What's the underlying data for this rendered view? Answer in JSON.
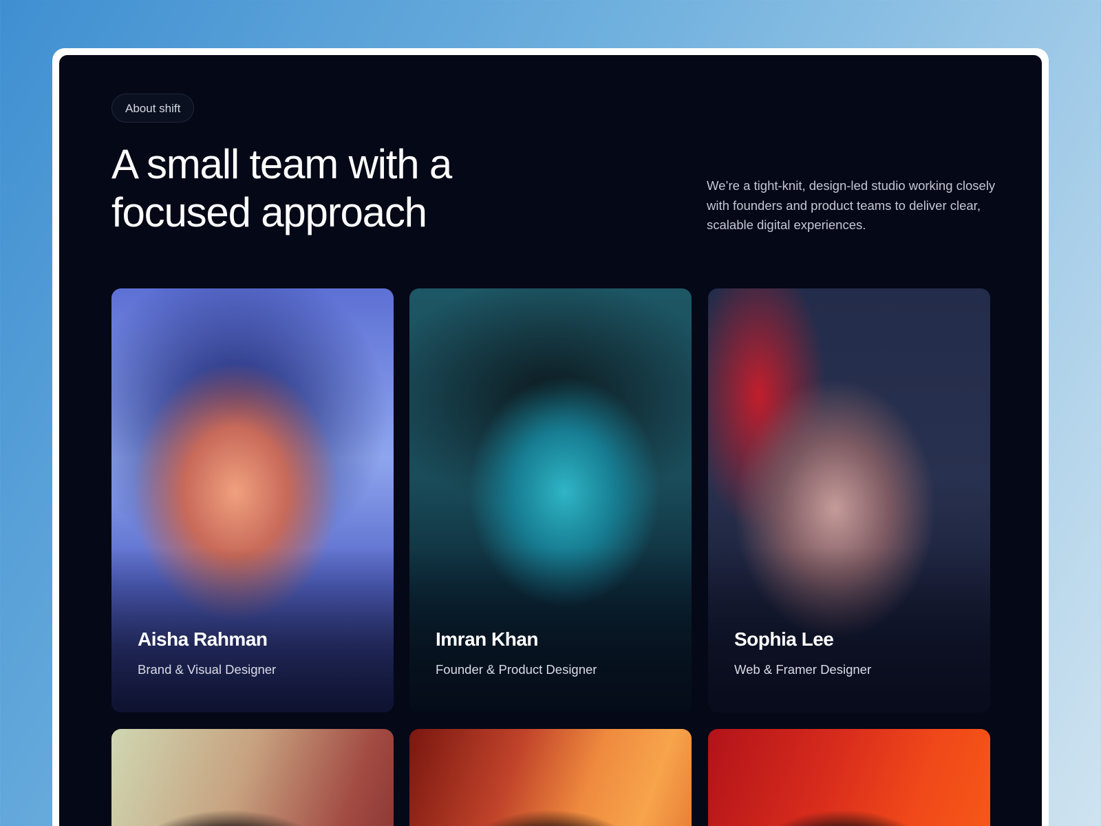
{
  "badge": {
    "label": "About shift"
  },
  "hero": {
    "title": "A small team with a focused approach",
    "description": "We’re a tight-knit, design-led studio working closely with founders and product teams to deliver clear, scalable digital experiences."
  },
  "team": {
    "members": [
      {
        "name": "Aisha Rahman",
        "role": "Brand & Visual Designer"
      },
      {
        "name": "Imran Khan",
        "role": "Founder & Product Designer"
      },
      {
        "name": "Sophia Lee",
        "role": "Web & Framer Designer"
      }
    ]
  },
  "colors": {
    "page_background": "#050816",
    "frame": "#ffffff",
    "text_primary": "#ffffff",
    "text_secondary": "#c4c8d4"
  }
}
